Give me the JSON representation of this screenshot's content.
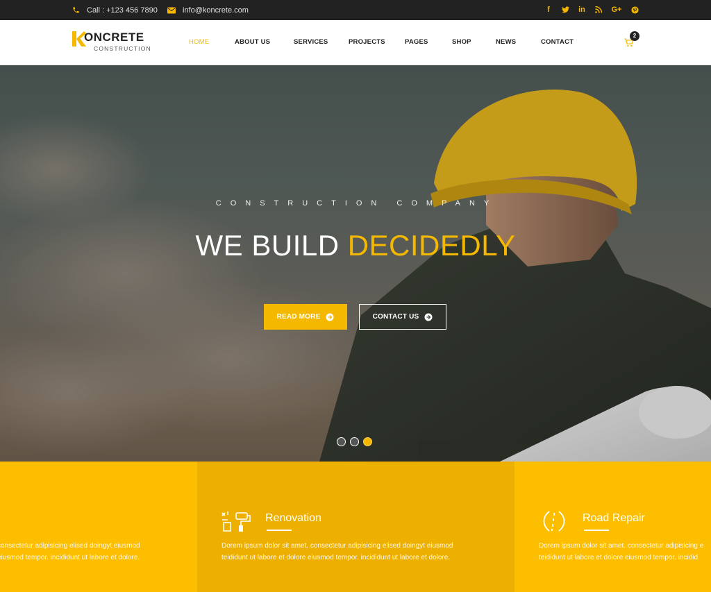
{
  "topbar": {
    "phone": "Call : +123 456 7890",
    "email": "info@koncrete.com",
    "socials": [
      {
        "icon": "facebook-icon",
        "glyph": "f"
      },
      {
        "icon": "twitter-icon",
        "glyph": "t"
      },
      {
        "icon": "linkedin-icon",
        "glyph": "in"
      },
      {
        "icon": "rss-icon",
        "glyph": "r"
      },
      {
        "icon": "google-plus-icon",
        "glyph": "G+"
      },
      {
        "icon": "pinterest-icon",
        "glyph": "p"
      }
    ]
  },
  "brand": {
    "name": "ONCRETE",
    "tagline": "CONSTRUCTION"
  },
  "nav": {
    "items": [
      {
        "label": "HOME",
        "active": true
      },
      {
        "label": "ABOUT US"
      },
      {
        "label": "SERVICES"
      },
      {
        "label": "PROJECTS"
      },
      {
        "label": "PAGES"
      },
      {
        "label": "SHOP"
      },
      {
        "label": "NEWS"
      },
      {
        "label": "CONTACT"
      }
    ],
    "cart_count": "2"
  },
  "hero": {
    "tagline": "CONSTRUCTION COMPANY",
    "headline_white": "WE BUILD",
    "headline_accent": "DECIDEDLY",
    "read_more": "READ MORE",
    "contact_us": "CONTACT US",
    "slide_count": 3,
    "active_slide": 3
  },
  "services": [
    {
      "title": "",
      "text_line1": "consectetur adipisicing elised doingyt eiusmod",
      "text_line2": "eiusmod tempor. incididunt ut labore et dolore."
    },
    {
      "title": "Renovation",
      "text_line1": "Dorem ipsum dolor sit amet, consectetur adipisicing elised doingyt eiusmod",
      "text_line2": "teididunt ut labore et dolore eiusmod tempor. incididunt ut labore et dolore."
    },
    {
      "title": "Road Repair",
      "text_line1": "Dorem ipsum dolor sit amet, consectetur adipisicing e",
      "text_line2": "teididunt ut labore et dolore eiusmod tempor. incidid"
    }
  ],
  "colors": {
    "accent": "#f5b800",
    "dark": "#222222",
    "strip_main": "#fdbe00",
    "strip_alt": "#eeb000"
  }
}
